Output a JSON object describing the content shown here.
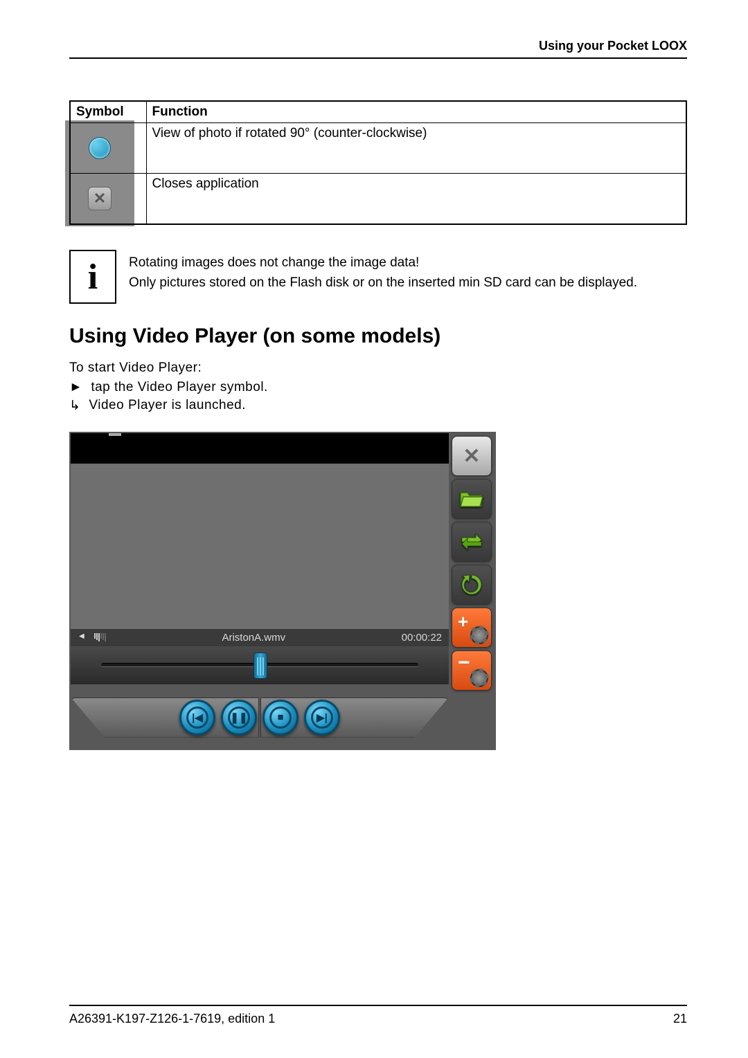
{
  "header": {
    "title": "Using your Pocket LOOX"
  },
  "symbol_table": {
    "headers": {
      "col1": "Symbol",
      "col2": "Function"
    },
    "rows": [
      {
        "icon": "rotate-ccw-icon",
        "function": "View of photo if rotated 90° (counter-clockwise)"
      },
      {
        "icon": "close-icon",
        "function": "Closes application"
      }
    ]
  },
  "info_note": {
    "line1": "Rotating images does not change the image data!",
    "line2": "Only pictures stored on the Flash disk or on the inserted min SD card can be displayed."
  },
  "section_heading": "Using Video Player (on some models)",
  "start_text": "To start Video Player:",
  "steps": {
    "action_marker": "►",
    "action": "tap the Video Player symbol.",
    "result_marker": "↳",
    "result": "Video Player is launched."
  },
  "video_player": {
    "filename": "AristonA.wmv",
    "timecode": "00:00:22",
    "controls": [
      "prev",
      "pause",
      "stop",
      "next"
    ],
    "side_buttons": [
      "close",
      "folder",
      "swap",
      "repeat",
      "volume-up",
      "volume-down"
    ]
  },
  "footer": {
    "doc_id": "A26391-K197-Z126-1-7619, edition 1",
    "page_number": "21"
  }
}
